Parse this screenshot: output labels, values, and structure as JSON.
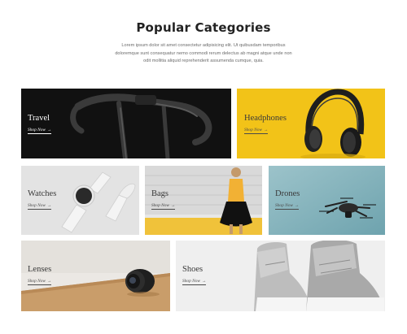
{
  "section": {
    "title": "Popular Categories",
    "description": "Lorem ipsum dolor sit amet consectetur adipisicing elit. Ut quibusdam temporibus doloremque sunt consequatur nemo commodi rerum delectus ab magni atque unde non odit mollitia aliquid reprehenderit assumenda cumque, quia."
  },
  "categories": [
    {
      "label": "Travel",
      "link": "Shop Now",
      "icon": "bicycle-handlebar-image",
      "bg": "#111111"
    },
    {
      "label": "Headphones",
      "link": "Shop Now",
      "icon": "headphones-image",
      "bg": "#f2c318"
    },
    {
      "label": "Watches",
      "link": "Shop Now",
      "icon": "smartwatch-image",
      "bg": "#e2e2e2"
    },
    {
      "label": "Bags",
      "link": "Shop Now",
      "icon": "woman-with-bag-image",
      "bg": "#dcdcdc"
    },
    {
      "label": "Drones",
      "link": "Shop Now",
      "icon": "drone-image",
      "bg": "#7fb0ba"
    },
    {
      "label": "Lenses",
      "link": "Shop Now",
      "icon": "camera-lens-image",
      "bg": "#ebe7e2"
    },
    {
      "label": "Shoes",
      "link": "Shop Now",
      "icon": "sneakers-image",
      "bg": "#eeeeee"
    }
  ],
  "arrow_glyph": "→"
}
